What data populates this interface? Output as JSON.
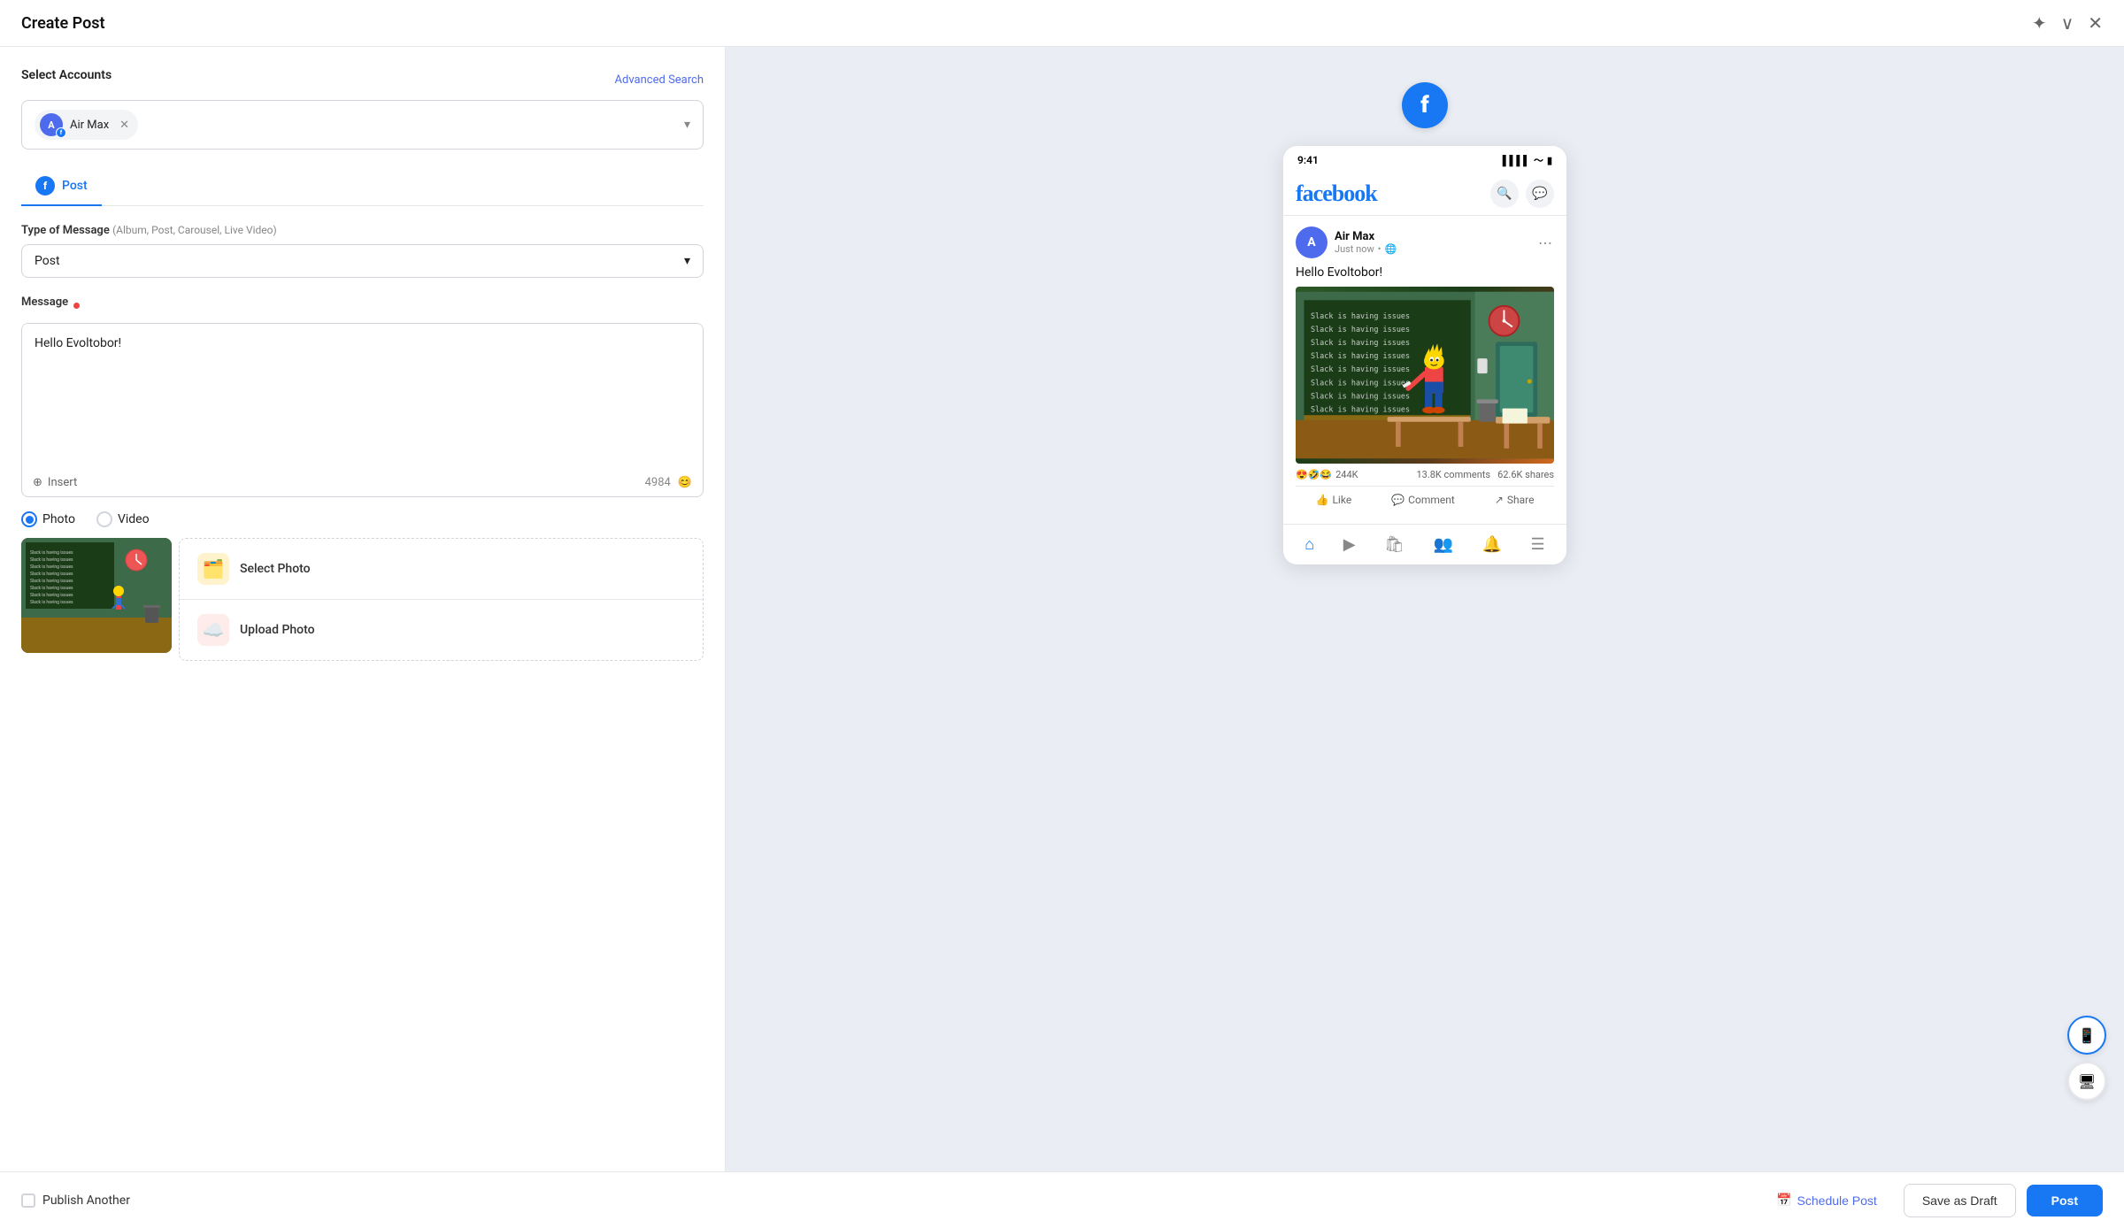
{
  "window": {
    "title": "Create Post"
  },
  "header": {
    "title": "Create Post",
    "pin_icon": "★",
    "minimize_icon": "∨",
    "close_icon": "✕"
  },
  "left": {
    "select_accounts_label": "Select Accounts",
    "advanced_search": "Advanced Search",
    "account": {
      "initial": "A",
      "name": "Air Max"
    },
    "tabs": [
      {
        "id": "post",
        "label": "Post",
        "active": true
      }
    ],
    "type_of_message": {
      "label": "Type of Message",
      "hint": "(Album, Post, Carousel, Live Video)",
      "value": "Post"
    },
    "message": {
      "label": "Message",
      "value": "Hello Evoltobor!",
      "char_count": "4984",
      "insert_label": "Insert"
    },
    "media_type": {
      "options": [
        "Photo",
        "Video"
      ],
      "selected": "Photo"
    },
    "photo_actions": [
      {
        "id": "select",
        "label": "Select Photo",
        "emoji": "🗂️"
      },
      {
        "id": "upload",
        "label": "Upload Photo",
        "emoji": "☁️"
      }
    ]
  },
  "preview": {
    "fb_icon": "f",
    "phone_time": "9:41",
    "fb_logo": "facebook",
    "post": {
      "author": "Air Max",
      "author_initial": "A",
      "timestamp": "Just now",
      "privacy": "🌐",
      "text": "Hello Evoltobor!",
      "reactions": "244K",
      "comments": "13.8K comments",
      "shares": "62.6K shares",
      "like_label": "Like",
      "comment_label": "Comment",
      "share_label": "Share"
    },
    "more_icon": "•••"
  },
  "bottom_bar": {
    "publish_another": "Publish Another",
    "schedule_post": "Schedule Post",
    "save_as_draft": "Save as Draft",
    "post": "Post"
  }
}
